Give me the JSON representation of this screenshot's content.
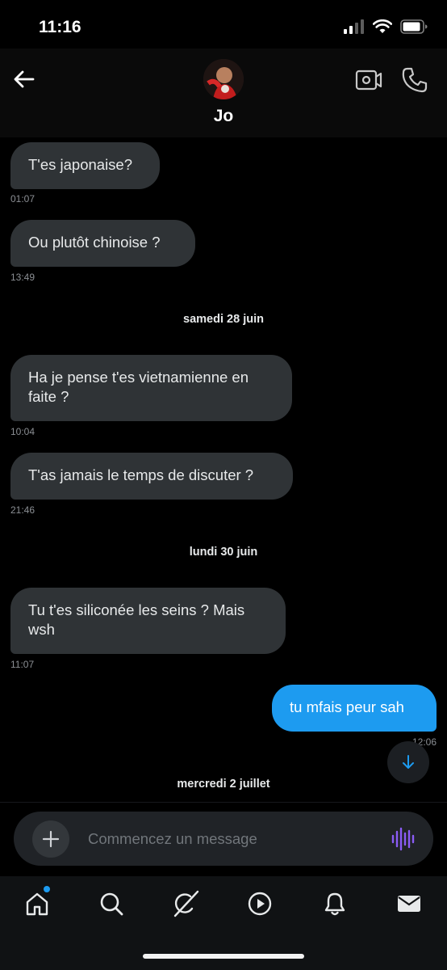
{
  "status_bar": {
    "time": "11:16",
    "icons": [
      "signal-icon",
      "wifi-icon",
      "battery-icon"
    ]
  },
  "header": {
    "contact_name": "Jo",
    "back_icon": "back-arrow-icon",
    "video_icon": "video-call-icon",
    "call_icon": "phone-icon"
  },
  "conversation": {
    "messages": [
      {
        "text": "T'es japonaise?",
        "time": "01:07",
        "direction": "in"
      },
      {
        "text": "Ou plutôt chinoise ?",
        "time": "13:49",
        "direction": "in"
      },
      {
        "text": "Ha je pense t'es vietnamienne en faite ?",
        "time": "10:04",
        "direction": "in"
      },
      {
        "text": "T'as jamais le temps de discuter ?",
        "time": "21:46",
        "direction": "in"
      },
      {
        "text": "Tu t'es siliconée les seins ? Mais wsh",
        "time": "11:07",
        "direction": "in"
      },
      {
        "text": "tu mfais peur sah",
        "time": "12:06",
        "direction": "out"
      }
    ],
    "day_separators": [
      "samedi 28 juin",
      "lundi 30 juin",
      "mercredi 2 juillet"
    ]
  },
  "composer": {
    "placeholder": "Commencez un message"
  },
  "tabbar": {
    "items": [
      "home-icon",
      "search-icon",
      "grok-icon",
      "video-icon",
      "notifications-icon",
      "messages-icon"
    ]
  },
  "colors": {
    "outgoing_bubble": "#1d9bf0",
    "incoming_bubble": "#2f3336",
    "accent_voice": "#8b5cf6"
  }
}
